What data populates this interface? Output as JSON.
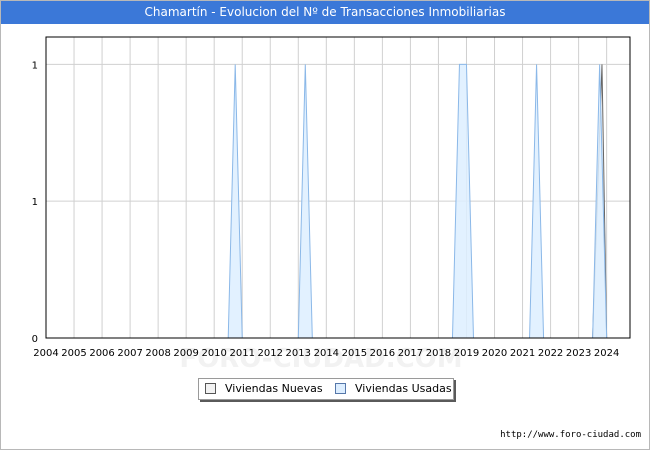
{
  "title": "Chamartín - Evolucion del Nº de Transacciones Inmobiliarias",
  "footer_url": "http://www.foro-ciudad.com",
  "watermark": "FORO-CIUDAD.COM",
  "colors": {
    "title_bg": "#3b78d8",
    "nuevas_fill": "#f2f2f2",
    "nuevas_stroke": "#666666",
    "usadas_fill": "#ddeeff",
    "usadas_stroke": "#8bb8e8"
  },
  "legend": {
    "nuevas_label": "Viviendas Nuevas",
    "usadas_label": "Viviendas Usadas"
  },
  "chart_data": {
    "type": "area",
    "title": "Chamartín - Evolucion del Nº de Transacciones Inmobiliarias",
    "x_ticks": [
      "2004",
      "2005",
      "2006",
      "2007",
      "2008",
      "2009",
      "2010",
      "2011",
      "2012",
      "2013",
      "2014",
      "2015",
      "2016",
      "2017",
      "2018",
      "2019",
      "2020",
      "2021",
      "2022",
      "2023",
      "2024"
    ],
    "y_ticks": [
      {
        "value": 0,
        "label": "0"
      },
      {
        "value": 0.5,
        "label": "1"
      },
      {
        "value": 1,
        "label": "1"
      }
    ],
    "xlim": [
      2004,
      2024.8333
    ],
    "ylim": [
      0,
      1.1
    ],
    "grid": true,
    "legend_position": "bottom",
    "series": [
      {
        "name": "Viviendas Nuevas",
        "points": [
          [
            2023.5,
            0
          ],
          [
            2023.8333,
            1
          ],
          [
            2024.0,
            0
          ]
        ]
      },
      {
        "name": "Viviendas Usadas",
        "points": [
          [
            2010.5,
            0
          ],
          [
            2010.75,
            1
          ],
          [
            2011.0,
            0
          ],
          [
            2013.0,
            0
          ],
          [
            2013.25,
            1
          ],
          [
            2013.5,
            0
          ],
          [
            2018.5,
            0
          ],
          [
            2018.75,
            1
          ],
          [
            2019.0,
            1
          ],
          [
            2019.25,
            0
          ],
          [
            2021.25,
            0
          ],
          [
            2021.5,
            1
          ],
          [
            2021.75,
            0
          ],
          [
            2023.5,
            0
          ],
          [
            2023.75,
            1
          ],
          [
            2024.0,
            0
          ]
        ]
      }
    ]
  }
}
